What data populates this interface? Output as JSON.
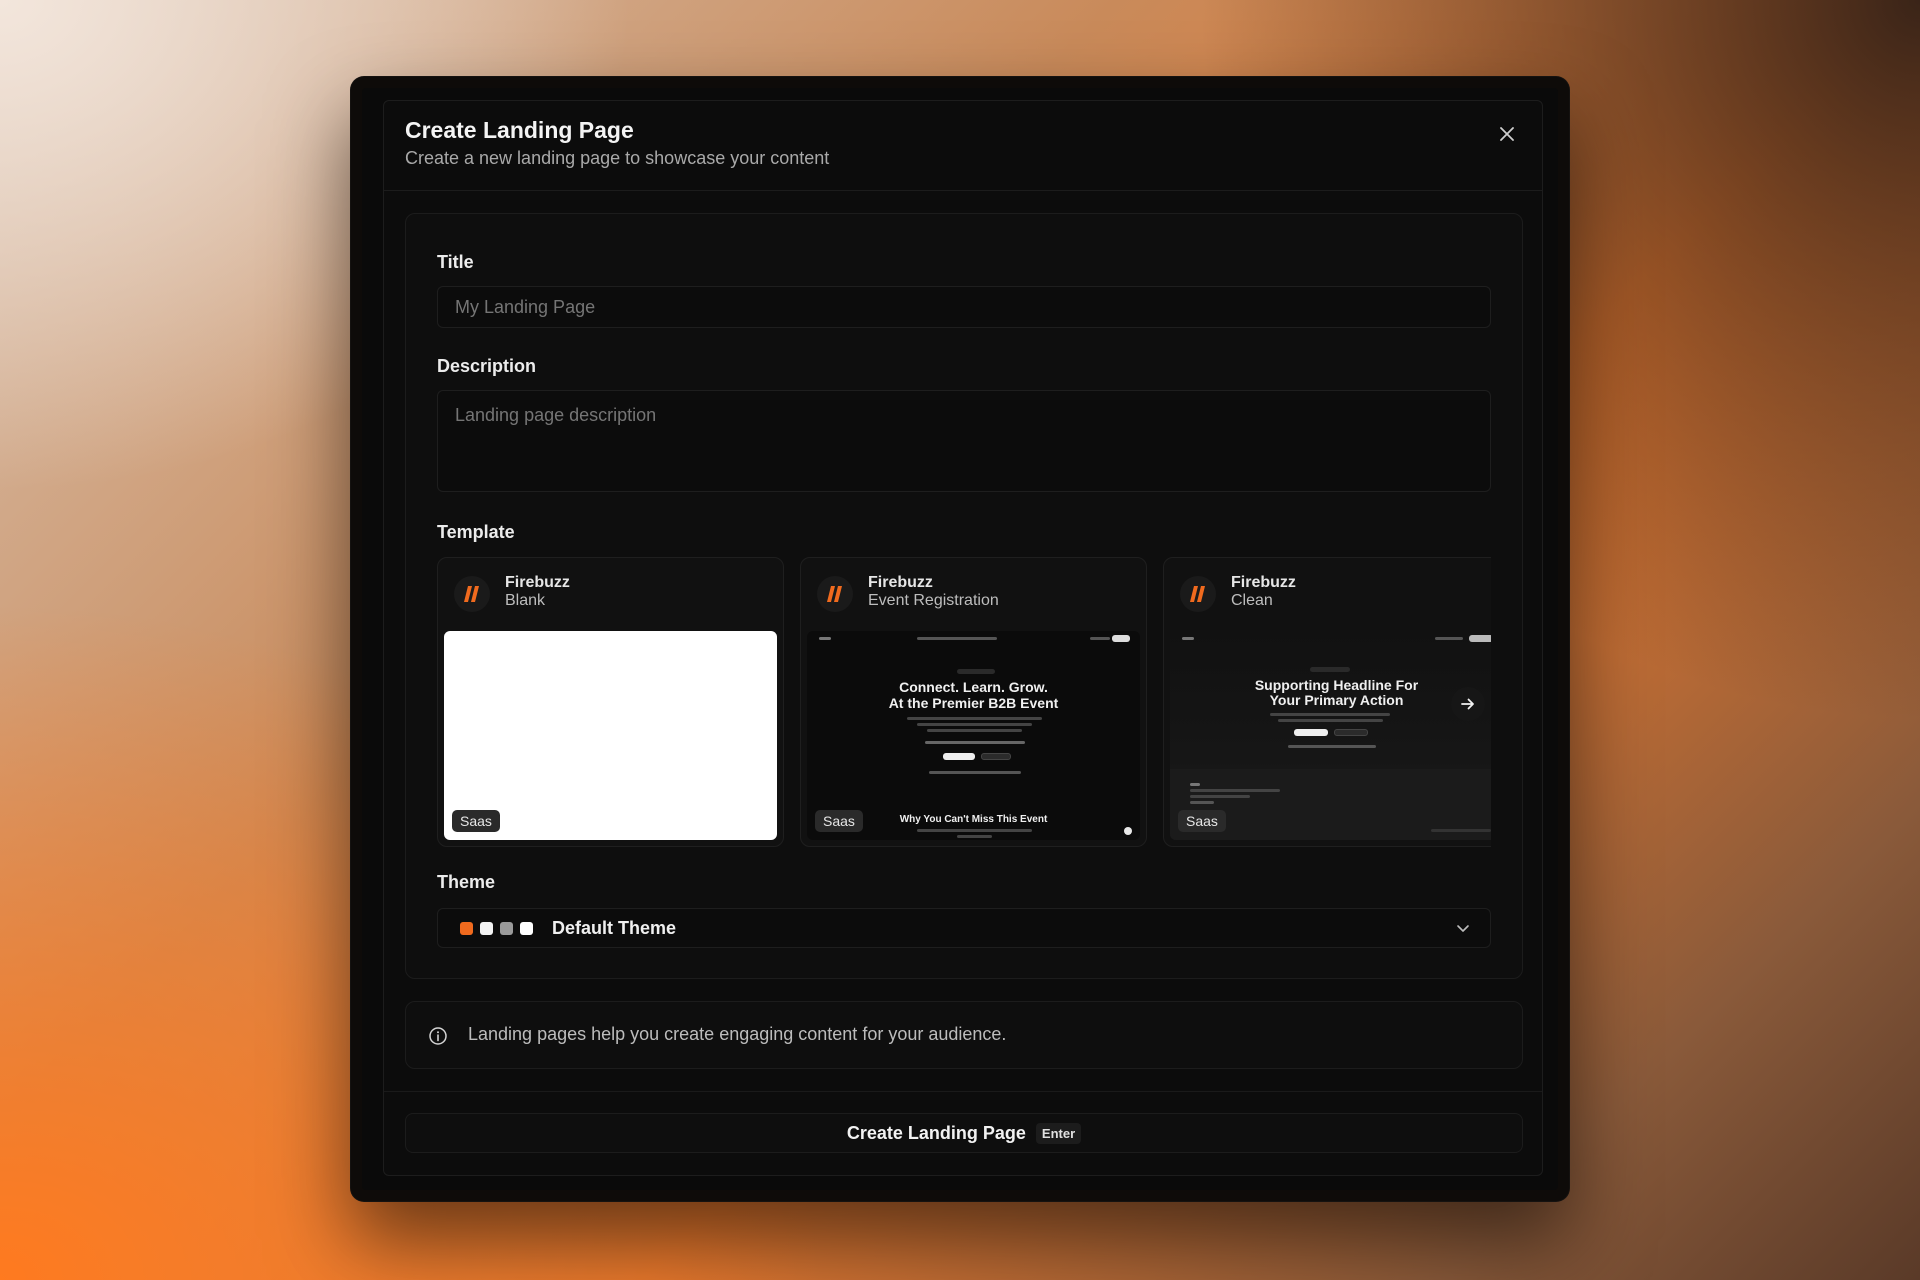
{
  "dialog": {
    "title": "Create Landing Page",
    "subtitle": "Create a new landing page to showcase your content"
  },
  "form": {
    "title_label": "Title",
    "title_placeholder": "My Landing Page",
    "description_label": "Description",
    "description_placeholder": "Landing page description",
    "template_label": "Template",
    "theme_label": "Theme"
  },
  "templates": [
    {
      "brand": "Firebuzz",
      "name": "Blank",
      "badge": "Saas"
    },
    {
      "brand": "Firebuzz",
      "name": "Event Registration",
      "badge": "Saas",
      "preview_headline_1": "Connect. Learn. Grow.",
      "preview_headline_2": "At the Premier B2B Event",
      "preview_section": "Why You Can't Miss This Event"
    },
    {
      "brand": "Firebuzz",
      "name": "Clean",
      "badge": "Saas",
      "preview_headline_1": "Supporting Headline For",
      "preview_headline_2": "Your Primary Action"
    }
  ],
  "theme": {
    "selected": "Default Theme",
    "swatches": [
      "#f06a1e",
      "#f2f2f2",
      "#9a9a9a",
      "#ffffff"
    ]
  },
  "info": {
    "text": "Landing pages help you create engaging content for your audience."
  },
  "footer": {
    "create_label": "Create Landing Page",
    "shortcut": "Enter"
  },
  "colors": {
    "accent": "#f06a1e"
  }
}
